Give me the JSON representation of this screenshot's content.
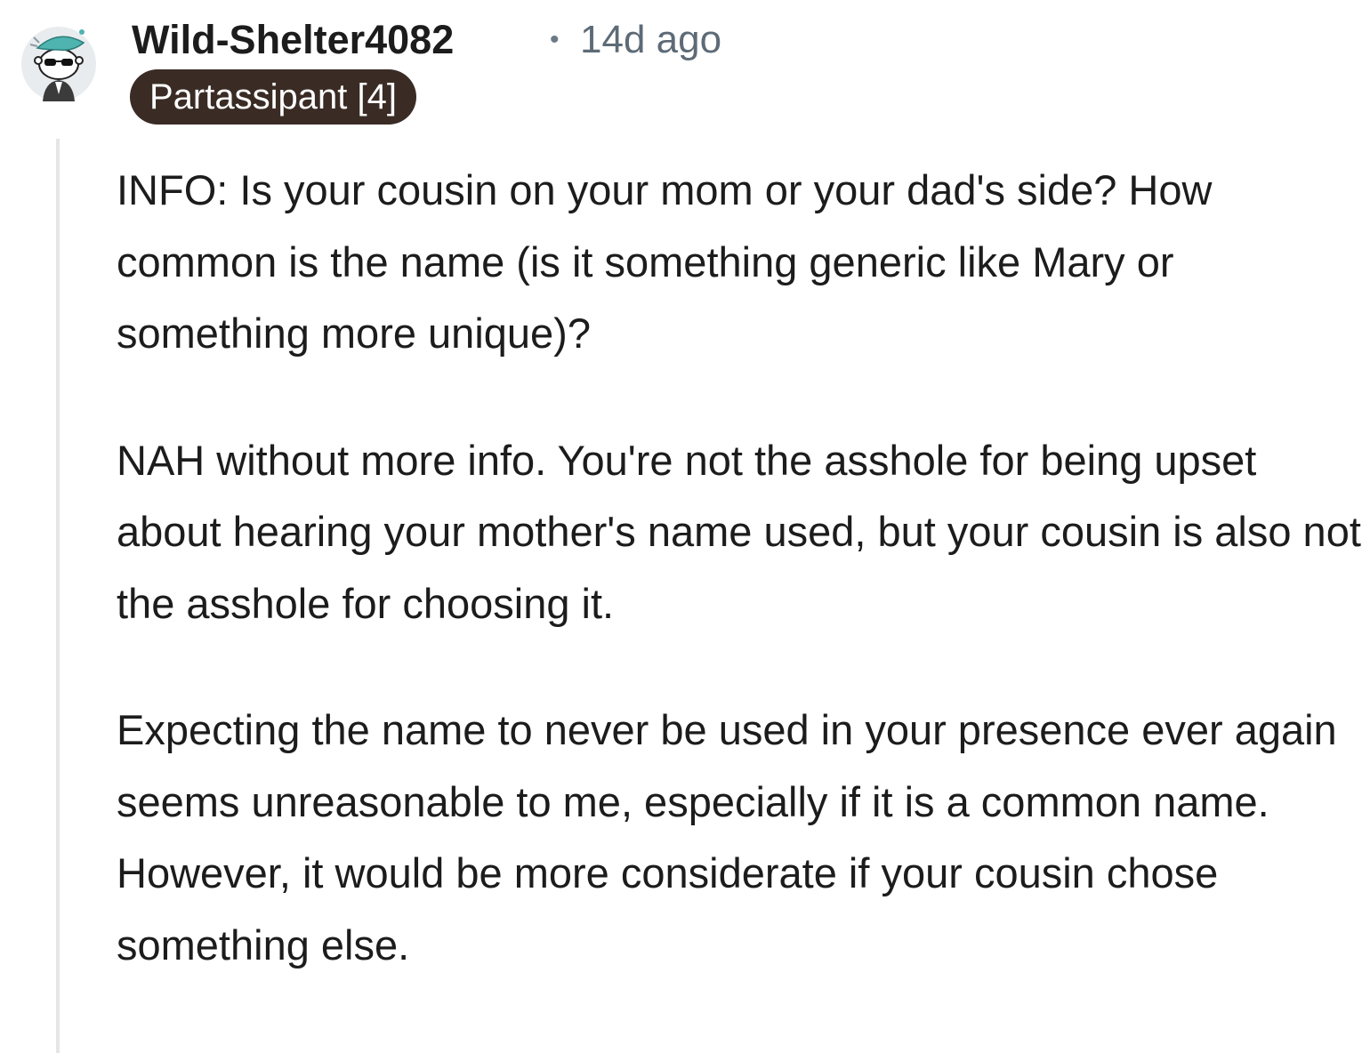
{
  "comment": {
    "author": "Wild-Shelter4082",
    "separator": "•",
    "timestamp": "14d ago",
    "flair": "Partassipant [4]",
    "avatar_icon": "snoo-avatar-with-sunglasses-and-teal-hat",
    "paragraphs": [
      "INFO: Is your cousin on your mom or your dad's side? How common is the name (is it something generic like Mary or something more unique)?",
      "NAH without more info. You're not the asshole for being upset about hearing your mother's name used, but your cousin is also not the asshole for choosing it.",
      "Expecting the name to never be used in your presence ever again seems unreasonable to me, especially if it is a common name. However, it would be more considerate if your cousin chose something else."
    ]
  },
  "colors": {
    "flair_background": "#3a2c25",
    "flair_text": "#ffffff",
    "thread_line": "#e4e6e8",
    "meta_text": "#5d6b77"
  }
}
